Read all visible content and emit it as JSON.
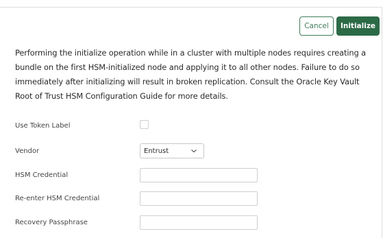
{
  "toolbar": {
    "cancel_label": "Cancel",
    "initialize_label": "Initialize"
  },
  "info_text": "Performing the initialize operation while in a cluster with multiple nodes requires creating a bundle on the first HSM-initialized node and applying it to all other nodes. Failure to do so immediately after initializing will result in broken replication. Consult the Oracle Key Vault Root of Trust HSM Configuration Guide for more details.",
  "form": {
    "use_token_label": {
      "label": "Use Token Label",
      "checked": false
    },
    "vendor": {
      "label": "Vendor",
      "value": "Entrust",
      "icon": "chevron-down-icon"
    },
    "hsm_credential": {
      "label": "HSM Credential",
      "value": ""
    },
    "reenter_hsm_credential": {
      "label": "Re-enter HSM Credential",
      "value": ""
    },
    "recovery_passphrase": {
      "label": "Recovery Passphrase",
      "value": ""
    }
  }
}
